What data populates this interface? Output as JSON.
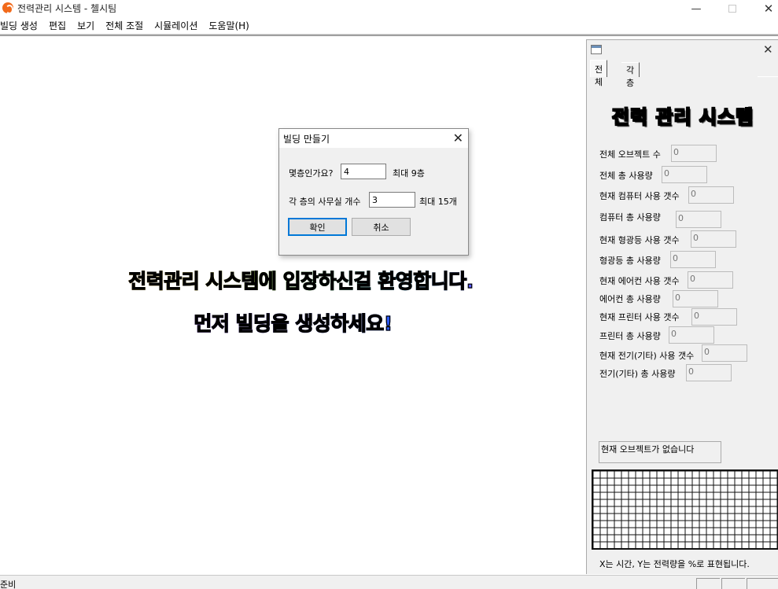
{
  "window": {
    "title": "전력관리 시스템 - 첼시팀",
    "app_icon": "power-app-icon",
    "min_symbol": "—",
    "close_symbol": "✕"
  },
  "menu": [
    "빌딩 생성",
    "편집",
    "보기",
    "전체 조절",
    "시뮬레이션",
    "도움말(H)"
  ],
  "welcome": {
    "line1": "전력관리 시스템에 입장하신걸 환영합니다.",
    "line2": "먼저 빌딩을 생성하세요!"
  },
  "dialog": {
    "title": "빌딩 만들기",
    "close_symbol": "✕",
    "floors_label": "몇층인가요?",
    "floors_value": "4",
    "floors_max": "최대 9층",
    "offices_label": "각 층의 사무실 개수",
    "offices_value": "3",
    "offices_max": "최대 15개",
    "ok": "확인",
    "cancel": "취소"
  },
  "panel": {
    "close_symbol": "✕",
    "tabs": [
      "전체",
      "각층"
    ],
    "title": "전력 관리 시스템",
    "stats": [
      {
        "label": "전체 오브젝트 수",
        "value": "0"
      },
      {
        "label": "전체 총 사용량",
        "value": "0"
      },
      {
        "label": "현재 컴퓨터 사용 갯수",
        "value": "0"
      },
      {
        "label": "컴퓨터 총 사용량",
        "value": "0"
      },
      {
        "label": "현재 형광등 사용 갯수",
        "value": "0"
      },
      {
        "label": "형광등 총 사용량",
        "value": "0"
      },
      {
        "label": "현재 에어컨 사용 갯수",
        "value": "0"
      },
      {
        "label": "에어컨 총 사용량",
        "value": "0"
      },
      {
        "label": "현재 프린터 사용 갯수",
        "value": "0"
      },
      {
        "label": "프린터 총 사용량",
        "value": "0"
      },
      {
        "label": "현재 전기(기타) 사용 갯수",
        "value": "0"
      },
      {
        "label": "전기(기타) 총 사용량",
        "value": "0"
      }
    ],
    "status_message": "현재 오브젝트가 없습니다",
    "chart_caption": "X는 시간, Y는 전력량을 %로 표현됩니다."
  },
  "statusbar": {
    "text": "준비"
  }
}
